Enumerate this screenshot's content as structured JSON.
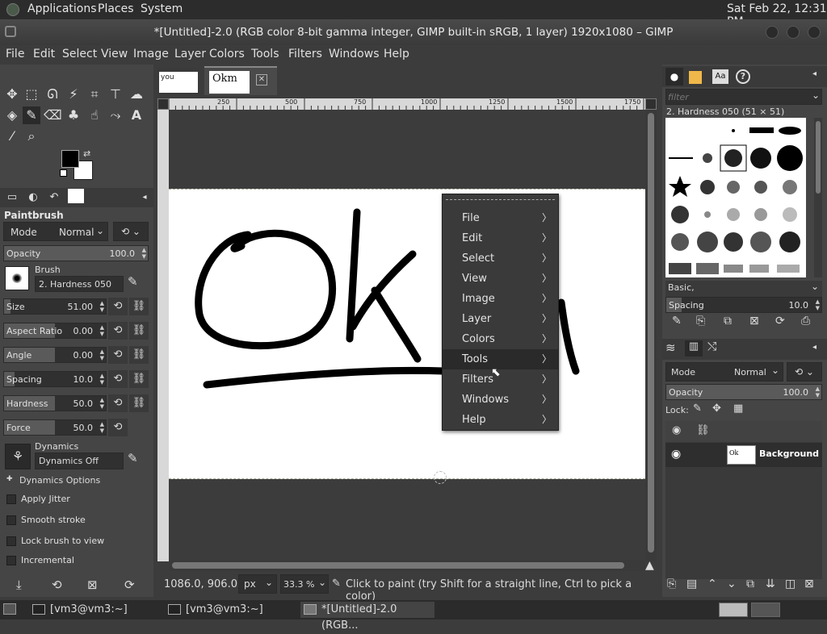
{
  "topbar": {
    "applications": "Applications",
    "places": "Places",
    "system": "System",
    "clock": "Sat Feb 22, 12:31 PM"
  },
  "window": {
    "title": "*[Untitled]-2.0 (RGB color 8-bit gamma integer, GIMP built-in sRGB, 1 layer) 1920x1080 – GIMP"
  },
  "menubar": [
    "File",
    "Edit",
    "Select",
    "View",
    "Image",
    "Layer",
    "Colors",
    "Tools",
    "Filters",
    "Windows",
    "Help"
  ],
  "tabs": {
    "thumb1_text": "you",
    "thumb2_text": "Okm"
  },
  "ruler": {
    "ticks": [
      "250",
      "500",
      "750",
      "1000",
      "1250",
      "1500",
      "1750"
    ]
  },
  "tool_options": {
    "title": "Paintbrush",
    "mode_label": "Mode",
    "mode_value": "Normal",
    "opacity_label": "Opacity",
    "opacity_value": "100.0",
    "opacity": 1.0,
    "brush_label": "Brush",
    "brush_value": "2. Hardness 050",
    "size_label": "Size",
    "size_value": "51.00",
    "size_frac": 0.06,
    "aspect_label": "Aspect Ratio",
    "aspect_value": "0.00",
    "aspect_frac": 0.5,
    "angle_label": "Angle",
    "angle_value": "0.00",
    "angle_frac": 0.5,
    "spacing_label": "Spacing",
    "spacing_value": "10.0",
    "spacing_frac": 0.1,
    "hardness_label": "Hardness",
    "hardness_value": "50.0",
    "hardness_frac": 0.5,
    "force_label": "Force",
    "force_value": "50.0",
    "force_frac": 0.5,
    "dynamics_label": "Dynamics",
    "dynamics_value": "Dynamics Off",
    "dynamics_options": "Dynamics Options",
    "apply_jitter": "Apply Jitter",
    "smooth_stroke": "Smooth stroke",
    "lock_brush": "Lock brush to view",
    "incremental": "Incremental"
  },
  "statusbar": {
    "coords": "1086.0, 906.0",
    "unit": "px",
    "zoom": "33.3 %",
    "message": "Click to paint (try Shift for a straight line, Ctrl to pick a color)"
  },
  "context_menu": {
    "items": [
      "File",
      "Edit",
      "Select",
      "View",
      "Image",
      "Layer",
      "Colors",
      "Tools",
      "Filters",
      "Windows",
      "Help"
    ],
    "highlighted": "Tools"
  },
  "brushes": {
    "filter_placeholder": "filter",
    "selected": "2. Hardness 050 (51 × 51)",
    "tag": "Basic,",
    "spacing_label": "Spacing",
    "spacing_value": "10.0",
    "spacing_frac": 0.1
  },
  "layers": {
    "mode_label": "Mode",
    "mode_value": "Normal",
    "opacity_label": "Opacity",
    "opacity_value": "100.0",
    "lock_label": "Lock:",
    "layer_name": "Background"
  },
  "canvas_text": "Ok",
  "taskbar": {
    "item1": "[vm3@vm3:~]",
    "item2": "[vm3@vm3:~]",
    "item3": "*[Untitled]-2.0 (RGB..."
  }
}
